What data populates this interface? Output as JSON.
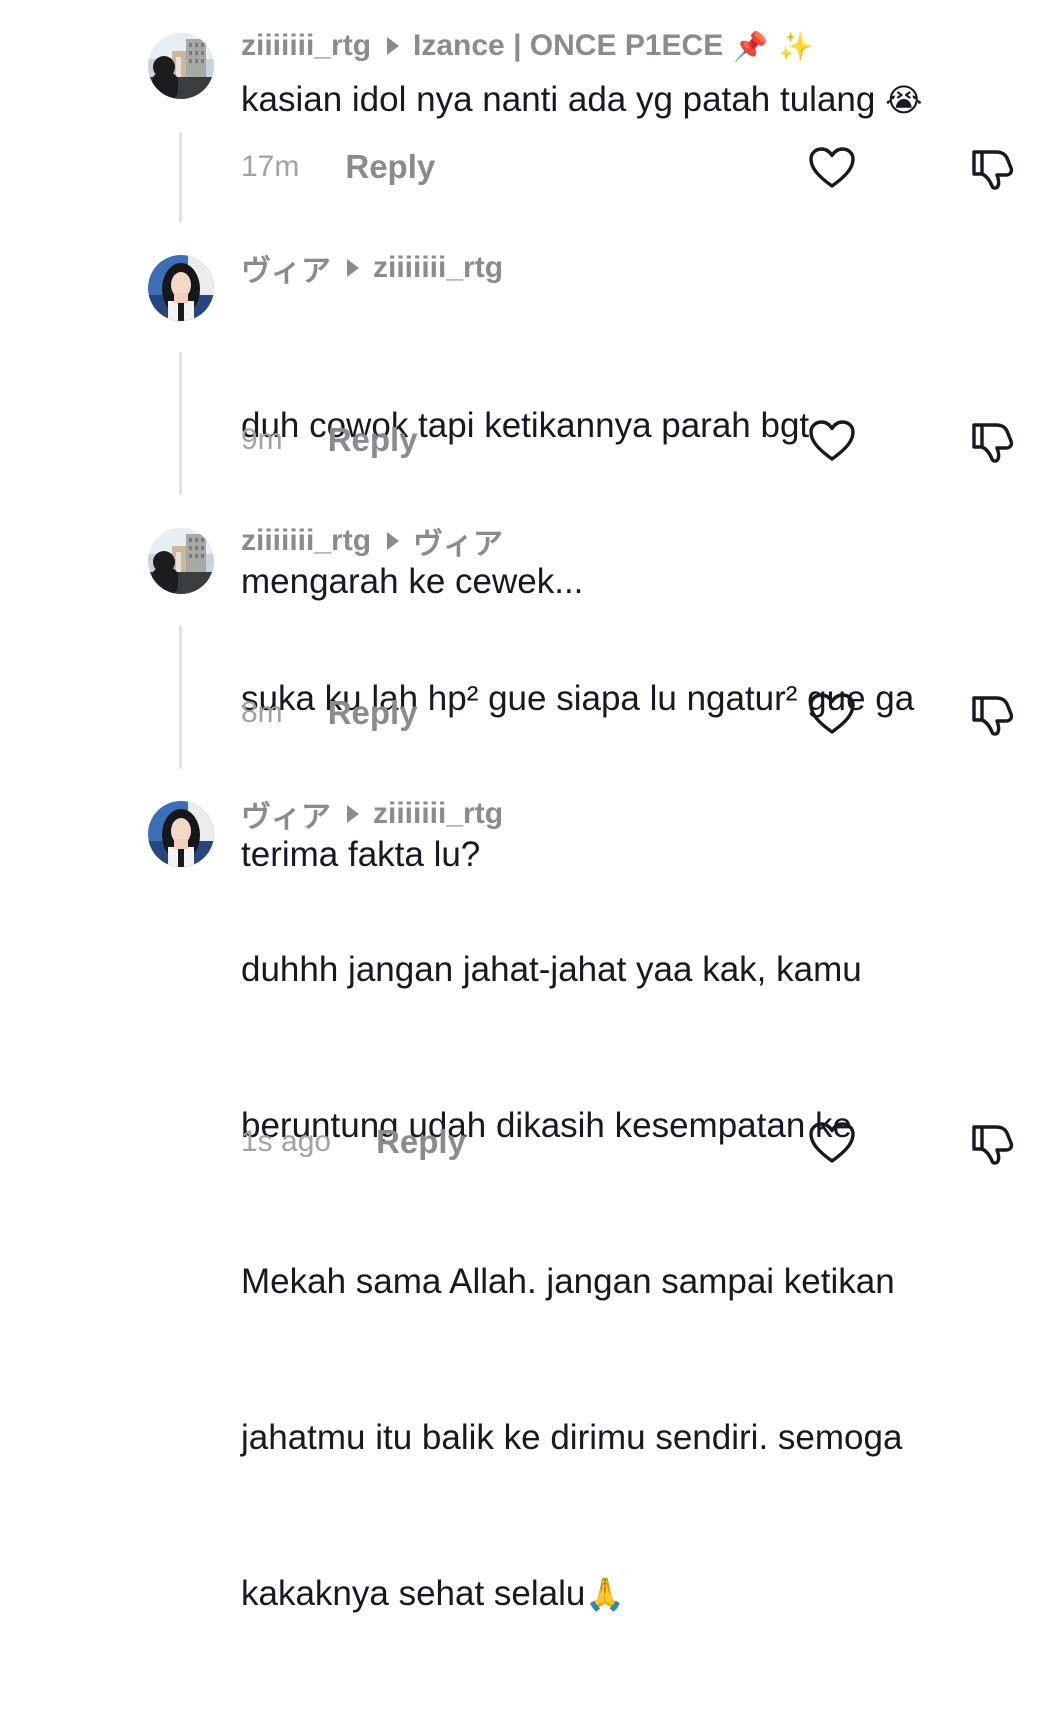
{
  "comments": [
    {
      "author": "ziiiiiii_rtg",
      "replying_to": "Izance | ONCE P1ECE",
      "header_emojis": [
        "📌",
        "✨"
      ],
      "text": "kasian idol nya nanti ada yg patah tulang ",
      "text_emoji": "😭",
      "time": "17m",
      "reply_label": "Reply",
      "avatar": "building-view-avatar"
    },
    {
      "author": "ヴィア",
      "replying_to": "ziiiiiii_rtg",
      "text_lines": [
        "duh cowok tapi ketikannya parah bgt",
        "mengarah ke cewek..."
      ],
      "time": "9m",
      "reply_label": "Reply",
      "avatar": "girl-portrait-avatar"
    },
    {
      "author": "ziiiiiii_rtg",
      "replying_to": "ヴィア",
      "text_lines": [
        "suka ku lah hp² gue siapa lu ngatur² gue ga",
        "terima fakta lu?"
      ],
      "time": "8m",
      "reply_label": "Reply",
      "avatar": "building-view-avatar"
    },
    {
      "author": "ヴィア",
      "replying_to": "ziiiiiii_rtg",
      "text_lines": [
        "duhhh jangan jahat-jahat yaa kak, kamu",
        "beruntung udah dikasih kesempatan ke",
        "Mekah sama Allah. jangan sampai ketikan",
        "jahatmu itu balik ke dirimu sendiri. semoga",
        "kakaknya sehat selalu"
      ],
      "text_emoji": "🙏",
      "time": "1s ago",
      "reply_label": "Reply",
      "avatar": "girl-portrait-avatar"
    }
  ],
  "icons": {
    "like": "heart-outline-icon",
    "dislike": "thumbs-down-outline-icon"
  },
  "colors": {
    "username": "#8a8b91",
    "body": "#161823",
    "meta": "#a1a2a7",
    "thread_line": "#e3e3e4"
  }
}
